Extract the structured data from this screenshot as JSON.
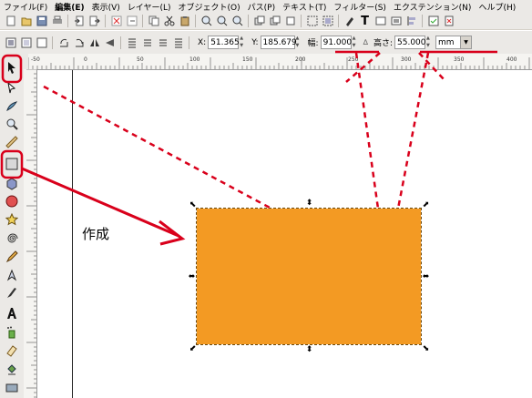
{
  "menu": [
    "ファイル(F)",
    "編集(E)",
    "表示(V)",
    "レイヤー(L)",
    "オブジェクト(O)",
    "パス(P)",
    "テキスト(T)",
    "フィルター(S)",
    "エクステンション(N)",
    "ヘルプ(H)"
  ],
  "toolbar2": {
    "x_label": "X:",
    "x_value": "51.365",
    "y_label": "Y:",
    "y_value": "185.679",
    "w_label": "幅:",
    "w_value": "91.000",
    "h_label": "高さ:",
    "h_value": "55.000",
    "unit": "mm"
  },
  "annotation": {
    "create_label": "作成"
  },
  "colors": {
    "rect_fill": "#f39a23",
    "annotation_red": "#d9001b",
    "ui_bg": "#ebe9e6"
  },
  "ruler_labels": [
    "-50",
    "0",
    "50",
    "100",
    "150",
    "200",
    "250",
    "300",
    "350",
    "400"
  ]
}
